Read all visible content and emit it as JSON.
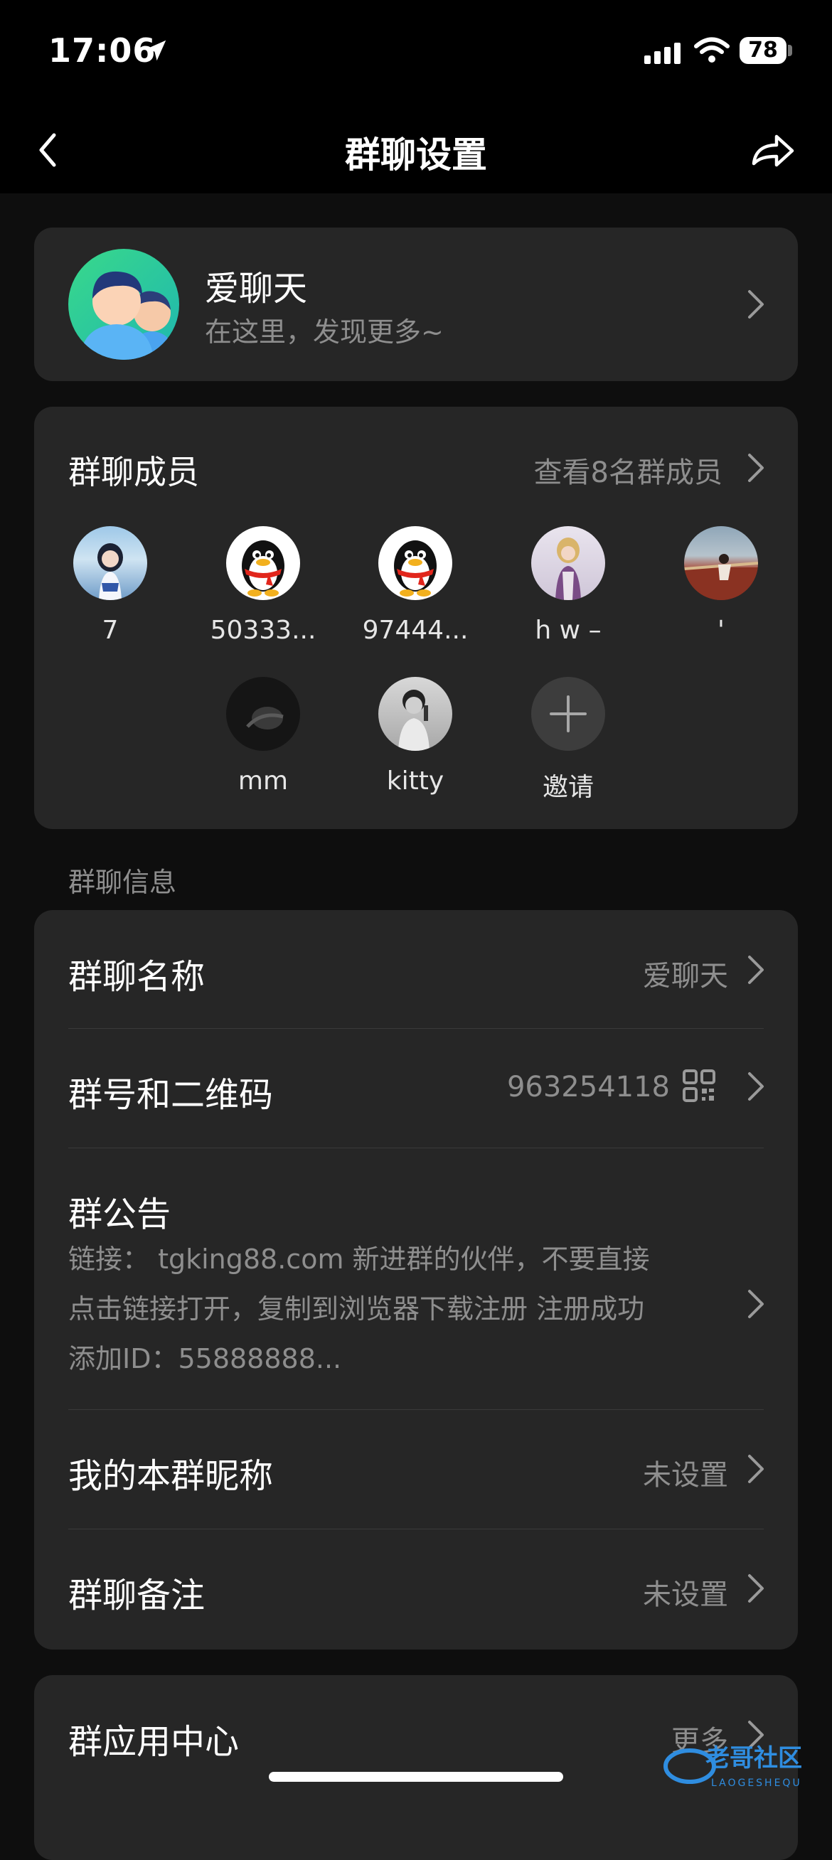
{
  "status": {
    "time": "17:06",
    "battery": "78"
  },
  "nav": {
    "title": "群聊设置"
  },
  "group": {
    "name": "爱聊天",
    "subtitle": "在这里，发现更多~"
  },
  "members": {
    "title": "群聊成员",
    "view_all": "查看8名群成员",
    "list": [
      {
        "name": "7"
      },
      {
        "name": "50333..."
      },
      {
        "name": "97444..."
      },
      {
        "name": "h w –"
      },
      {
        "name": "'"
      },
      {
        "name": "mm"
      },
      {
        "name": "kitty"
      },
      {
        "name": "邀请"
      }
    ]
  },
  "info": {
    "section": "群聊信息",
    "name_label": "群聊名称",
    "name_value": "爱聊天",
    "id_label": "群号和二维码",
    "id_value": "963254118",
    "notice_label": "群公告",
    "notice_line1": "链接： tgking88.com 新进群的伙伴，不要直接",
    "notice_line2": "点击链接打开，复制到浏览器下载注册 注册成功",
    "notice_line3": "添加ID：55888888...",
    "nick_label": "我的本群昵称",
    "nick_value": "未设置",
    "remark_label": "群聊备注",
    "remark_value": "未设置"
  },
  "apps": {
    "label": "群应用中心",
    "more": "更多"
  },
  "watermark": {
    "text": "老哥社区",
    "sub": "LAOGESHEQU"
  }
}
